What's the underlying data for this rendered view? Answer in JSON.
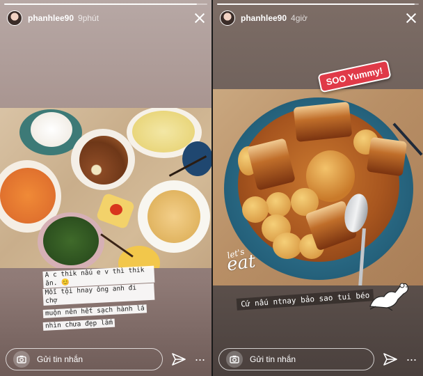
{
  "stories": [
    {
      "username": "phanhlee90",
      "time": "9phút",
      "caption_lines": [
        "A c thik nấu e v thì thik ăn. 😊",
        "Mỗi tội hnay ông anh đi chợ",
        "muộn nên hết sạch hành lá",
        "nhìn chưa đẹp lắm"
      ],
      "reply_placeholder": "Gửi tin nhắn",
      "progress": 0.95
    },
    {
      "username": "phanhlee90",
      "time": "4giờ",
      "sticker_yummy": "SOO Yummy!",
      "sticker_lets": "let's",
      "sticker_eat": "eat",
      "caption": "Cứ nấu ntnay bảo sao tui béo",
      "reply_placeholder": "Gửi tin nhắn",
      "progress": 0.98
    }
  ],
  "icons": [
    "close-icon",
    "camera-icon",
    "send-icon",
    "more-icon"
  ],
  "colors": {
    "yummy_sticker": "#e03a48",
    "bowl_blue": "#2f6f8a"
  }
}
